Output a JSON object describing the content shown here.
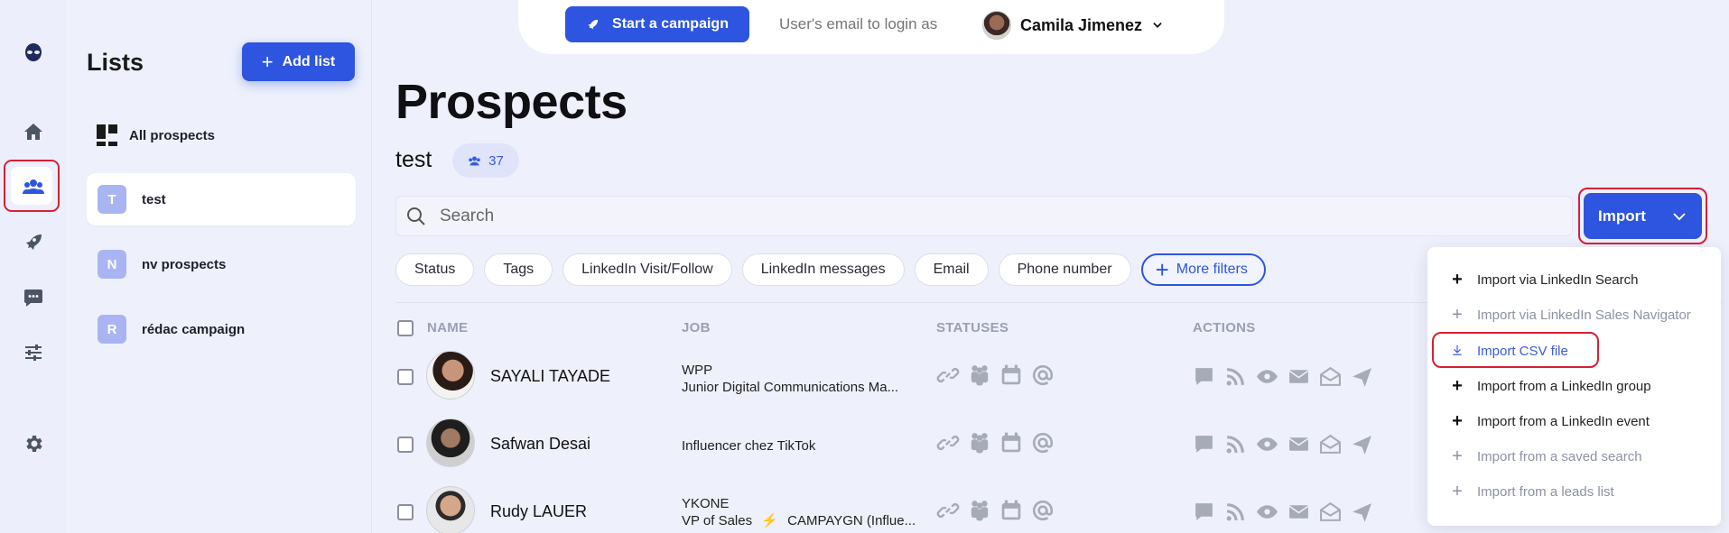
{
  "colors": {
    "accent": "#2e55e0",
    "highlight": "#d72035",
    "muted_icon": "#a6abb8"
  },
  "nav": {
    "icons": [
      "alien-logo-icon",
      "home-icon",
      "users-icon",
      "rocket-icon",
      "chat-icon",
      "sliders-icon",
      "gear-icon"
    ],
    "active": "users-icon"
  },
  "topbar": {
    "start_campaign": "Start a campaign",
    "login_placeholder": "User's email to login as",
    "user_name": "Camila Jimenez"
  },
  "lists_panel": {
    "title": "Lists",
    "add_list": "Add list",
    "items": [
      {
        "initial": "",
        "label": "All prospects"
      },
      {
        "initial": "T",
        "label": "test"
      },
      {
        "initial": "N",
        "label": "nv prospects"
      },
      {
        "initial": "R",
        "label": "rédac campaign"
      }
    ]
  },
  "main": {
    "title": "Prospects",
    "list_name": "test",
    "count": "37",
    "search_placeholder": "Search",
    "import_label": "Import",
    "filters": [
      "Status",
      "Tags",
      "LinkedIn Visit/Follow",
      "LinkedIn messages",
      "Email",
      "Phone number"
    ],
    "more_filters": "More filters",
    "columns": {
      "name": "NAME",
      "job": "JOB",
      "statuses": "STATUSES",
      "actions": "ACTIONS"
    },
    "rows": [
      {
        "name": "SAYALI TAYADE",
        "job_line1": "WPP",
        "job_line2": "Junior Digital Communications Ma..."
      },
      {
        "name": "Safwan Desai",
        "job_line1": "Influencer chez TikTok",
        "job_line2": ""
      },
      {
        "name": "Rudy LAUER",
        "job_line1": "YKONE",
        "job_line2": "VP of Sales",
        "job_campaign": "CAMPAYGN (Influe..."
      }
    ]
  },
  "import_menu": {
    "items": [
      {
        "label": "Import via LinkedIn Search",
        "state": "enabled",
        "icon": "plus-icon"
      },
      {
        "label": "Import via LinkedIn Sales Navigator",
        "state": "disabled",
        "icon": "plus-icon"
      },
      {
        "label": "Import CSV file",
        "state": "selected",
        "icon": "download-icon"
      },
      {
        "label": "Import from a LinkedIn group",
        "state": "enabled",
        "icon": "plus-icon"
      },
      {
        "label": "Import from a LinkedIn event",
        "state": "enabled",
        "icon": "plus-icon"
      },
      {
        "label": "Import from a saved search",
        "state": "disabled",
        "icon": "plus-icon"
      },
      {
        "label": "Import from a leads list",
        "state": "disabled",
        "icon": "plus-icon"
      }
    ]
  }
}
